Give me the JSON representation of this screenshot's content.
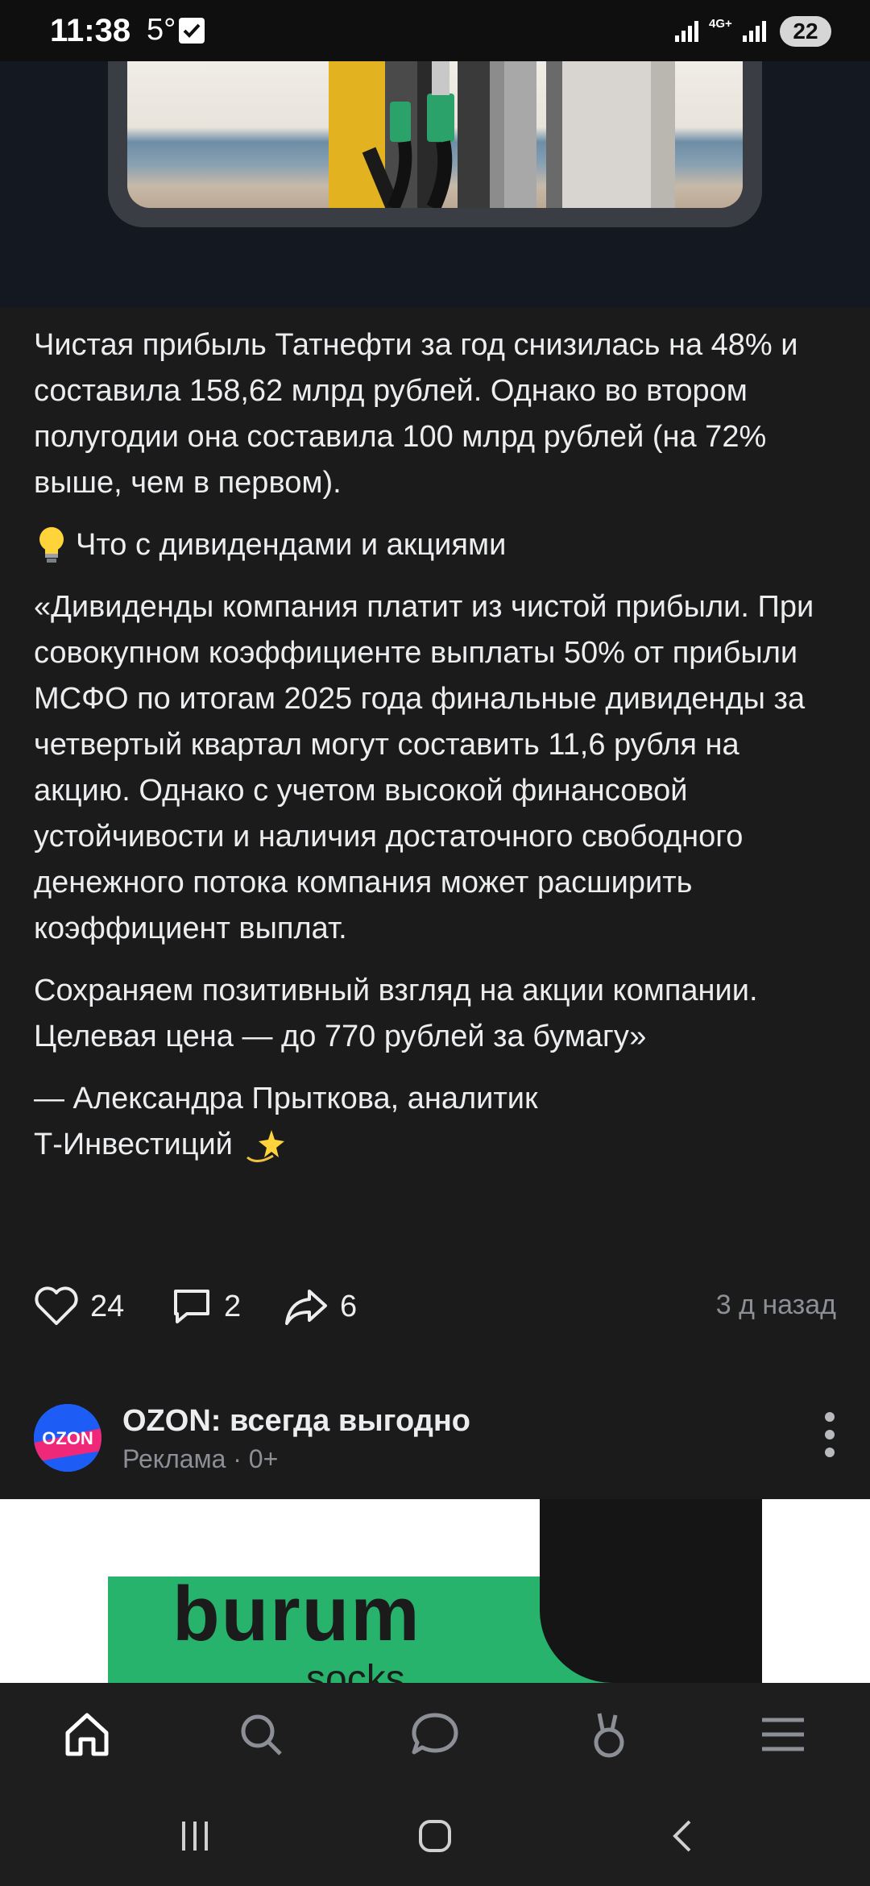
{
  "status_bar": {
    "time": "11:38",
    "temperature": "5°",
    "network": "4G+",
    "battery": "22"
  },
  "article": {
    "paragraph1": "Чистая прибыль Татнефти за год снизилась на 48% и составила 158,62 млрд рублей. Однако во втором полугодии она составила 100 млрд рублей (на 72% выше, чем в первом).",
    "subheading": "Что с дивидендами и акциями",
    "paragraph2": "«Дивиденды компания платит из чистой прибыли. При совокупном коэффициенте выплаты 50% от прибыли МСФО по итогам 2025 года финальные дивиденды за четвертый квартал могут составить 11,6 рубля на акцию. Однако с учетом высокой финансовой устойчивости и наличия достаточного свободного денежного потока компания может расширить коэффициент выплат.",
    "paragraph3": "Сохраняем позитивный взгляд на акции компании. Целевая цена — до 770 рублей за бумагу»",
    "attribution_line1": "— Александра Прыткова, аналитик",
    "attribution_line2": "Т-Инвестиций"
  },
  "actions": {
    "likes": "24",
    "comments": "2",
    "shares": "6",
    "time_ago": "3 д назад"
  },
  "ad": {
    "title": "OZON: всегда выгодно",
    "subtitle": "Реклама · 0+",
    "brand": "burum",
    "brand_sub": "socks",
    "avatar_text": "OZON"
  },
  "icons": {
    "status_check": "check-icon",
    "bulb": "light-bulb-icon",
    "sparkle": "dizzy-star-icon",
    "like": "heart-icon",
    "comment": "comment-icon",
    "share": "share-arrow-icon",
    "more": "more-vertical-icon",
    "nav": [
      "home-icon",
      "search-icon",
      "messages-icon",
      "bunny-icon",
      "menu-icon"
    ],
    "system": [
      "recents-icon",
      "home-circle-icon",
      "back-icon"
    ]
  },
  "colors": {
    "background": "#1b1b1c",
    "text": "#ecedef",
    "muted": "#8c8f95",
    "ad_green": "#27b36b"
  }
}
